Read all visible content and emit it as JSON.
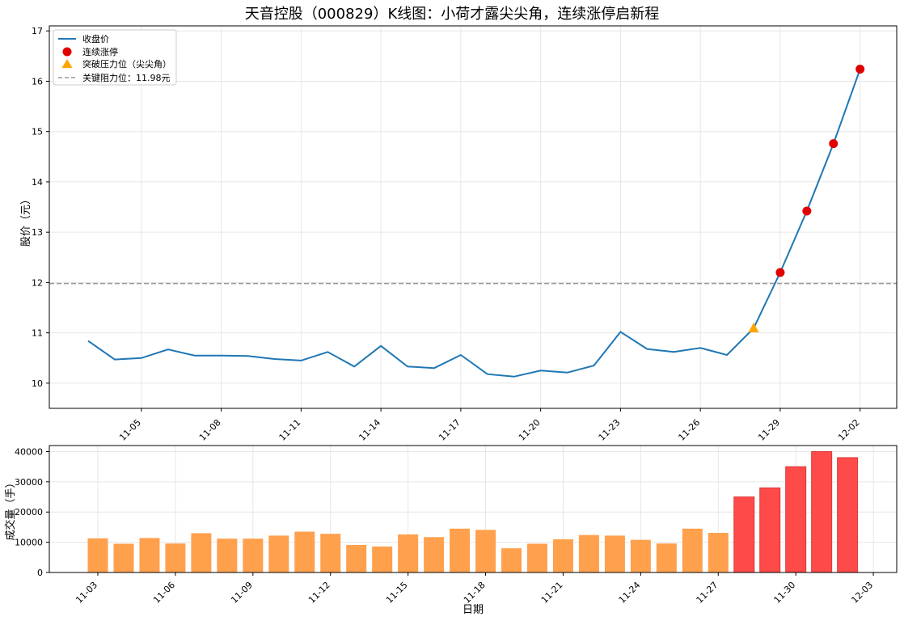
{
  "chart_data": [
    {
      "type": "line",
      "title": "天音控股（000829）K线图：小荷才露尖尖角，连续涨停启新程",
      "ylabel": "股价（元）",
      "xlabel": "",
      "ylim": [
        9.5,
        17.1
      ],
      "yticks": [
        10,
        11,
        12,
        13,
        14,
        15,
        16,
        17
      ],
      "xtick_labels": [
        "11-05",
        "11-08",
        "11-11",
        "11-14",
        "11-17",
        "11-20",
        "11-23",
        "11-26",
        "11-29",
        "12-02"
      ],
      "x": [
        "11-03",
        "11-04",
        "11-05",
        "11-06",
        "11-07",
        "11-08",
        "11-09",
        "11-10",
        "11-11",
        "11-12",
        "11-13",
        "11-14",
        "11-15",
        "11-16",
        "11-17",
        "11-18",
        "11-19",
        "11-20",
        "11-21",
        "11-22",
        "11-23",
        "11-24",
        "11-25",
        "11-26",
        "11-27",
        "11-28",
        "11-29",
        "11-30",
        "12-01",
        "12-02"
      ],
      "series": [
        {
          "name": "收盘价",
          "color": "#1f77b4",
          "values": [
            10.84,
            10.47,
            10.5,
            10.67,
            10.55,
            10.55,
            10.54,
            10.48,
            10.45,
            10.62,
            10.33,
            10.74,
            10.33,
            10.3,
            10.56,
            10.18,
            10.13,
            10.25,
            10.21,
            10.35,
            11.02,
            10.68,
            10.62,
            10.7,
            10.56,
            11.09,
            12.2,
            13.42,
            14.76,
            16.24
          ]
        }
      ],
      "markers": [
        {
          "name": "连续涨停",
          "shape": "circle",
          "color": "#e00000",
          "points": [
            {
              "x": "11-29",
              "y": 12.2
            },
            {
              "x": "11-30",
              "y": 13.42
            },
            {
              "x": "12-01",
              "y": 14.76
            },
            {
              "x": "12-02",
              "y": 16.24
            }
          ]
        },
        {
          "name": "突破压力位（尖尖角）",
          "shape": "triangle",
          "color": "#ffa500",
          "points": [
            {
              "x": "11-28",
              "y": 11.09
            }
          ]
        }
      ],
      "hline": {
        "name": "关键阻力位：11.98元",
        "value": 11.98,
        "color": "#999999"
      },
      "grid": true,
      "legend_position": "top-left"
    },
    {
      "type": "bar",
      "ylabel": "成交量（手）",
      "xlabel": "日期",
      "ylim": [
        0,
        42000
      ],
      "yticks": [
        0,
        10000,
        20000,
        30000,
        40000
      ],
      "xtick_labels": [
        "11-03",
        "11-06",
        "11-09",
        "11-12",
        "11-15",
        "11-18",
        "11-21",
        "11-24",
        "11-27",
        "11-30",
        "12-03"
      ],
      "categories": [
        "11-03",
        "11-04",
        "11-05",
        "11-06",
        "11-07",
        "11-08",
        "11-09",
        "11-10",
        "11-11",
        "11-12",
        "11-13",
        "11-14",
        "11-15",
        "11-16",
        "11-17",
        "11-18",
        "11-19",
        "11-20",
        "11-21",
        "11-22",
        "11-23",
        "11-24",
        "11-25",
        "11-26",
        "11-27",
        "11-28",
        "11-29",
        "11-30",
        "12-01",
        "12-02"
      ],
      "values": [
        11300,
        9500,
        11400,
        9600,
        13000,
        11200,
        11200,
        12200,
        13500,
        12800,
        9100,
        8600,
        12600,
        11700,
        14500,
        14100,
        8000,
        9500,
        11000,
        12400,
        12200,
        10800,
        9600,
        14500,
        13100,
        25000,
        28000,
        35000,
        40000,
        38000
      ],
      "bar_colors": {
        "normal": "#ffa04d",
        "limit_up": "#ff4a4a"
      },
      "limit_up_from_index": 25,
      "grid": true
    }
  ]
}
